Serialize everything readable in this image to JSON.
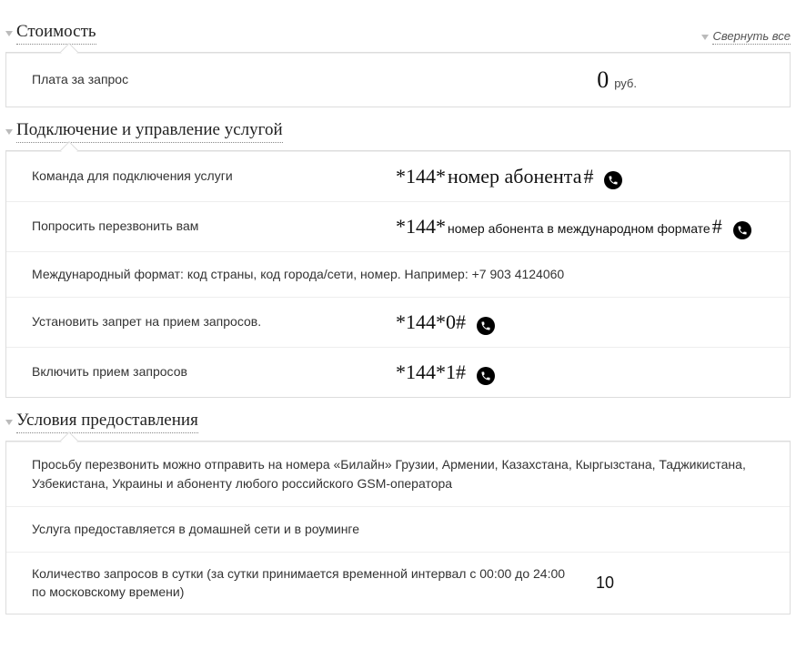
{
  "collapse_all": "Свернуть все",
  "sections": {
    "cost": {
      "title": "Стоимость",
      "fee_label": "Плата за запрос",
      "fee_value": "0",
      "fee_unit": "руб."
    },
    "manage": {
      "title": "Подключение и управление услугой",
      "rows": {
        "r1_label": "Команда для подключения услуги",
        "r1_code_a": "*144*",
        "r1_code_b": "номер абонента",
        "r1_code_c": "#",
        "r2_label": "Попросить перезвонить вам",
        "r2_code_a": "*144*",
        "r2_code_b": "номер абонента в международном формате",
        "r2_code_c": "#",
        "r3_text": "Международный формат: код страны, код города/сети, номер. Например: +7 903 4124060",
        "r4_label": "Установить запрет на прием запросов.",
        "r4_code": "*144*0#",
        "r5_label": "Включить прием запросов",
        "r5_code": "*144*1#"
      }
    },
    "terms": {
      "title": "Условия предоставления",
      "t1": "Просьбу перезвонить можно отправить на номера «Билайн» Грузии, Армении, Казахстана, Кыргызстана, Таджикистана, Узбекистана, Украины и абоненту любого российского GSM-оператора",
      "t2": "Услуга предоставляется в домашней сети и в роуминге",
      "t3_label": "Количество запросов в сутки (за сутки принимается временной интервал с 00:00 до 24:00 по московскому времени)",
      "t3_value": "10"
    }
  }
}
